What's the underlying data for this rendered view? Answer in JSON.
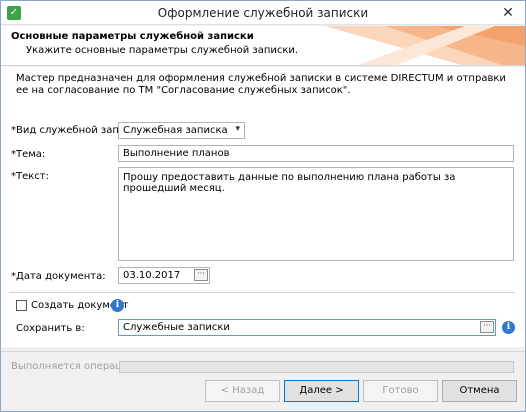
{
  "window": {
    "title": "Оформление служебной записки",
    "close_glyph": "✕",
    "icon_glyph": "✓"
  },
  "header": {
    "title": "Основные параметры служебной записки",
    "subtitle": "Укажите основные параметры служебной записки."
  },
  "intro": "Мастер предназначен для оформления служебной записки в системе DIRECTUM и отправки ее на согласование по ТМ \"Согласование служебных записок\".",
  "form": {
    "kind_label": "*Вид служебной записки:",
    "kind_value": "Служебная записка",
    "topic_label": "*Тема:",
    "topic_value": "Выполнение планов",
    "text_label": "*Текст:",
    "text_value": "Прошу предоставить данные по выполнению плана работы за прошедший месяц.",
    "date_label": "*Дата документа:",
    "date_value": "03.10.2017",
    "create_doc_label": "Создать документ",
    "create_doc_checked": false,
    "save_label": "Сохранить в:",
    "save_value": "Служебные записки",
    "dots": "···",
    "info_glyph": "i",
    "dropdown_glyph": "▾"
  },
  "status": {
    "operation_label": "Выполняется операция",
    "progress": 0
  },
  "buttons": {
    "back": "< Назад",
    "next": "Далее >",
    "done": "Готово",
    "cancel": "Отмена"
  },
  "colors": {
    "accent": "#0078d7",
    "info": "#2f78d0",
    "deco": "#f4a26b"
  }
}
